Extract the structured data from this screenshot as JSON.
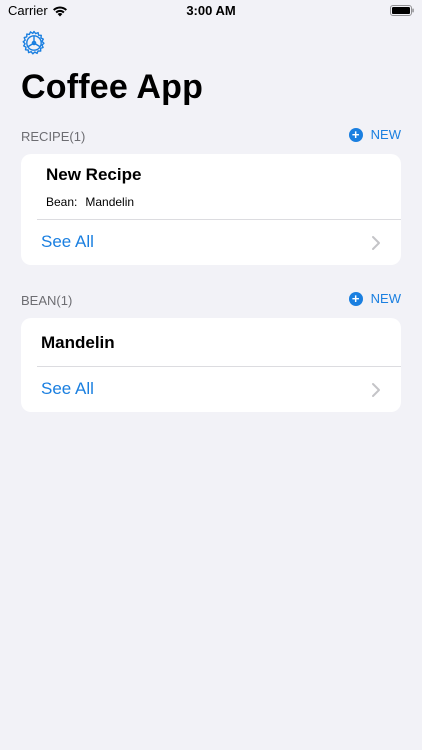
{
  "status_bar": {
    "carrier": "Carrier",
    "time": "3:00 AM"
  },
  "header": {
    "title": "Coffee App"
  },
  "recipe_section": {
    "label": "RECIPE(1)",
    "new_label": "NEW",
    "item": {
      "title": "New Recipe",
      "bean_label": "Bean:",
      "bean_value": "Mandelin"
    },
    "see_all_label": "See All"
  },
  "bean_section": {
    "label": "BEAN(1)",
    "new_label": "NEW",
    "item": {
      "title": "Mandelin"
    },
    "see_all_label": "See All"
  },
  "colors": {
    "accent": "#1A7FE0",
    "background": "#F2F2F7",
    "card": "#FFFFFF",
    "section_label": "#6D6D72"
  },
  "icons": {
    "settings": "gear-icon",
    "new": "plus-circle-icon",
    "disclosure": "chevron-right-icon"
  }
}
